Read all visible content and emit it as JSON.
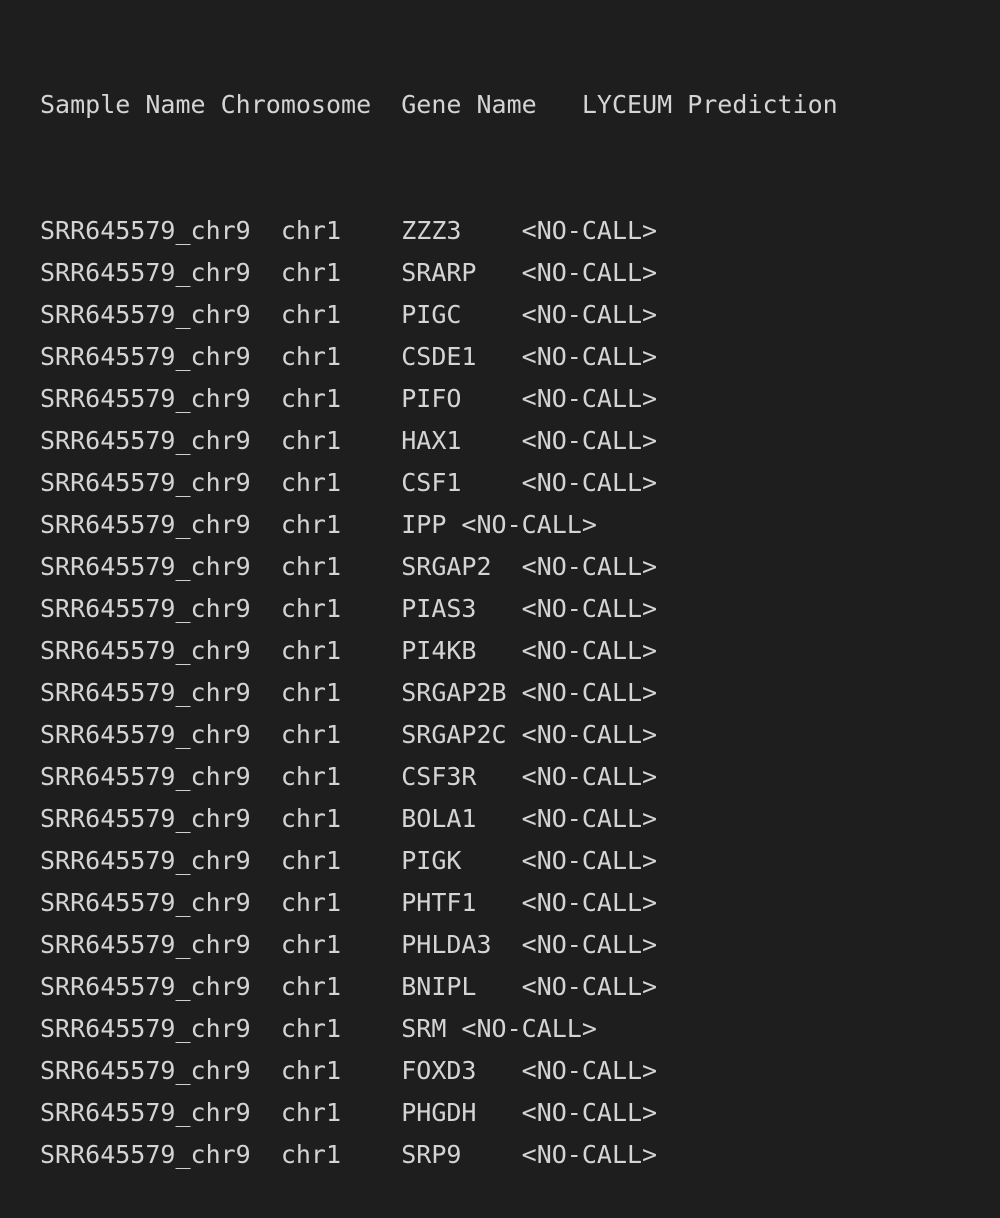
{
  "terminal": {
    "header": "Sample Name Chromosome  Gene Name   LYCEUM Prediction",
    "rows": [
      "SRR645579_chr9  chr1    ZZZ3    <NO-CALL>",
      "SRR645579_chr9  chr1    SRARP   <NO-CALL>",
      "SRR645579_chr9  chr1    PIGC    <NO-CALL>",
      "SRR645579_chr9  chr1    CSDE1   <NO-CALL>",
      "SRR645579_chr9  chr1    PIFO    <NO-CALL>",
      "SRR645579_chr9  chr1    HAX1    <NO-CALL>",
      "SRR645579_chr9  chr1    CSF1    <NO-CALL>",
      "SRR645579_chr9  chr1    IPP <NO-CALL>",
      "SRR645579_chr9  chr1    SRGAP2  <NO-CALL>",
      "SRR645579_chr9  chr1    PIAS3   <NO-CALL>",
      "SRR645579_chr9  chr1    PI4KB   <NO-CALL>",
      "SRR645579_chr9  chr1    SRGAP2B <NO-CALL>",
      "SRR645579_chr9  chr1    SRGAP2C <NO-CALL>",
      "SRR645579_chr9  chr1    CSF3R   <NO-CALL>",
      "SRR645579_chr9  chr1    BOLA1   <NO-CALL>",
      "SRR645579_chr9  chr1    PIGK    <NO-CALL>",
      "SRR645579_chr9  chr1    PHTF1   <NO-CALL>",
      "SRR645579_chr9  chr1    PHLDA3  <NO-CALL>",
      "SRR645579_chr9  chr1    BNIPL   <NO-CALL>",
      "SRR645579_chr9  chr1    SRM <NO-CALL>",
      "SRR645579_chr9  chr1    FOXD3   <NO-CALL>",
      "SRR645579_chr9  chr1    PHGDH   <NO-CALL>",
      "SRR645579_chr9  chr1    SRP9    <NO-CALL>"
    ]
  }
}
